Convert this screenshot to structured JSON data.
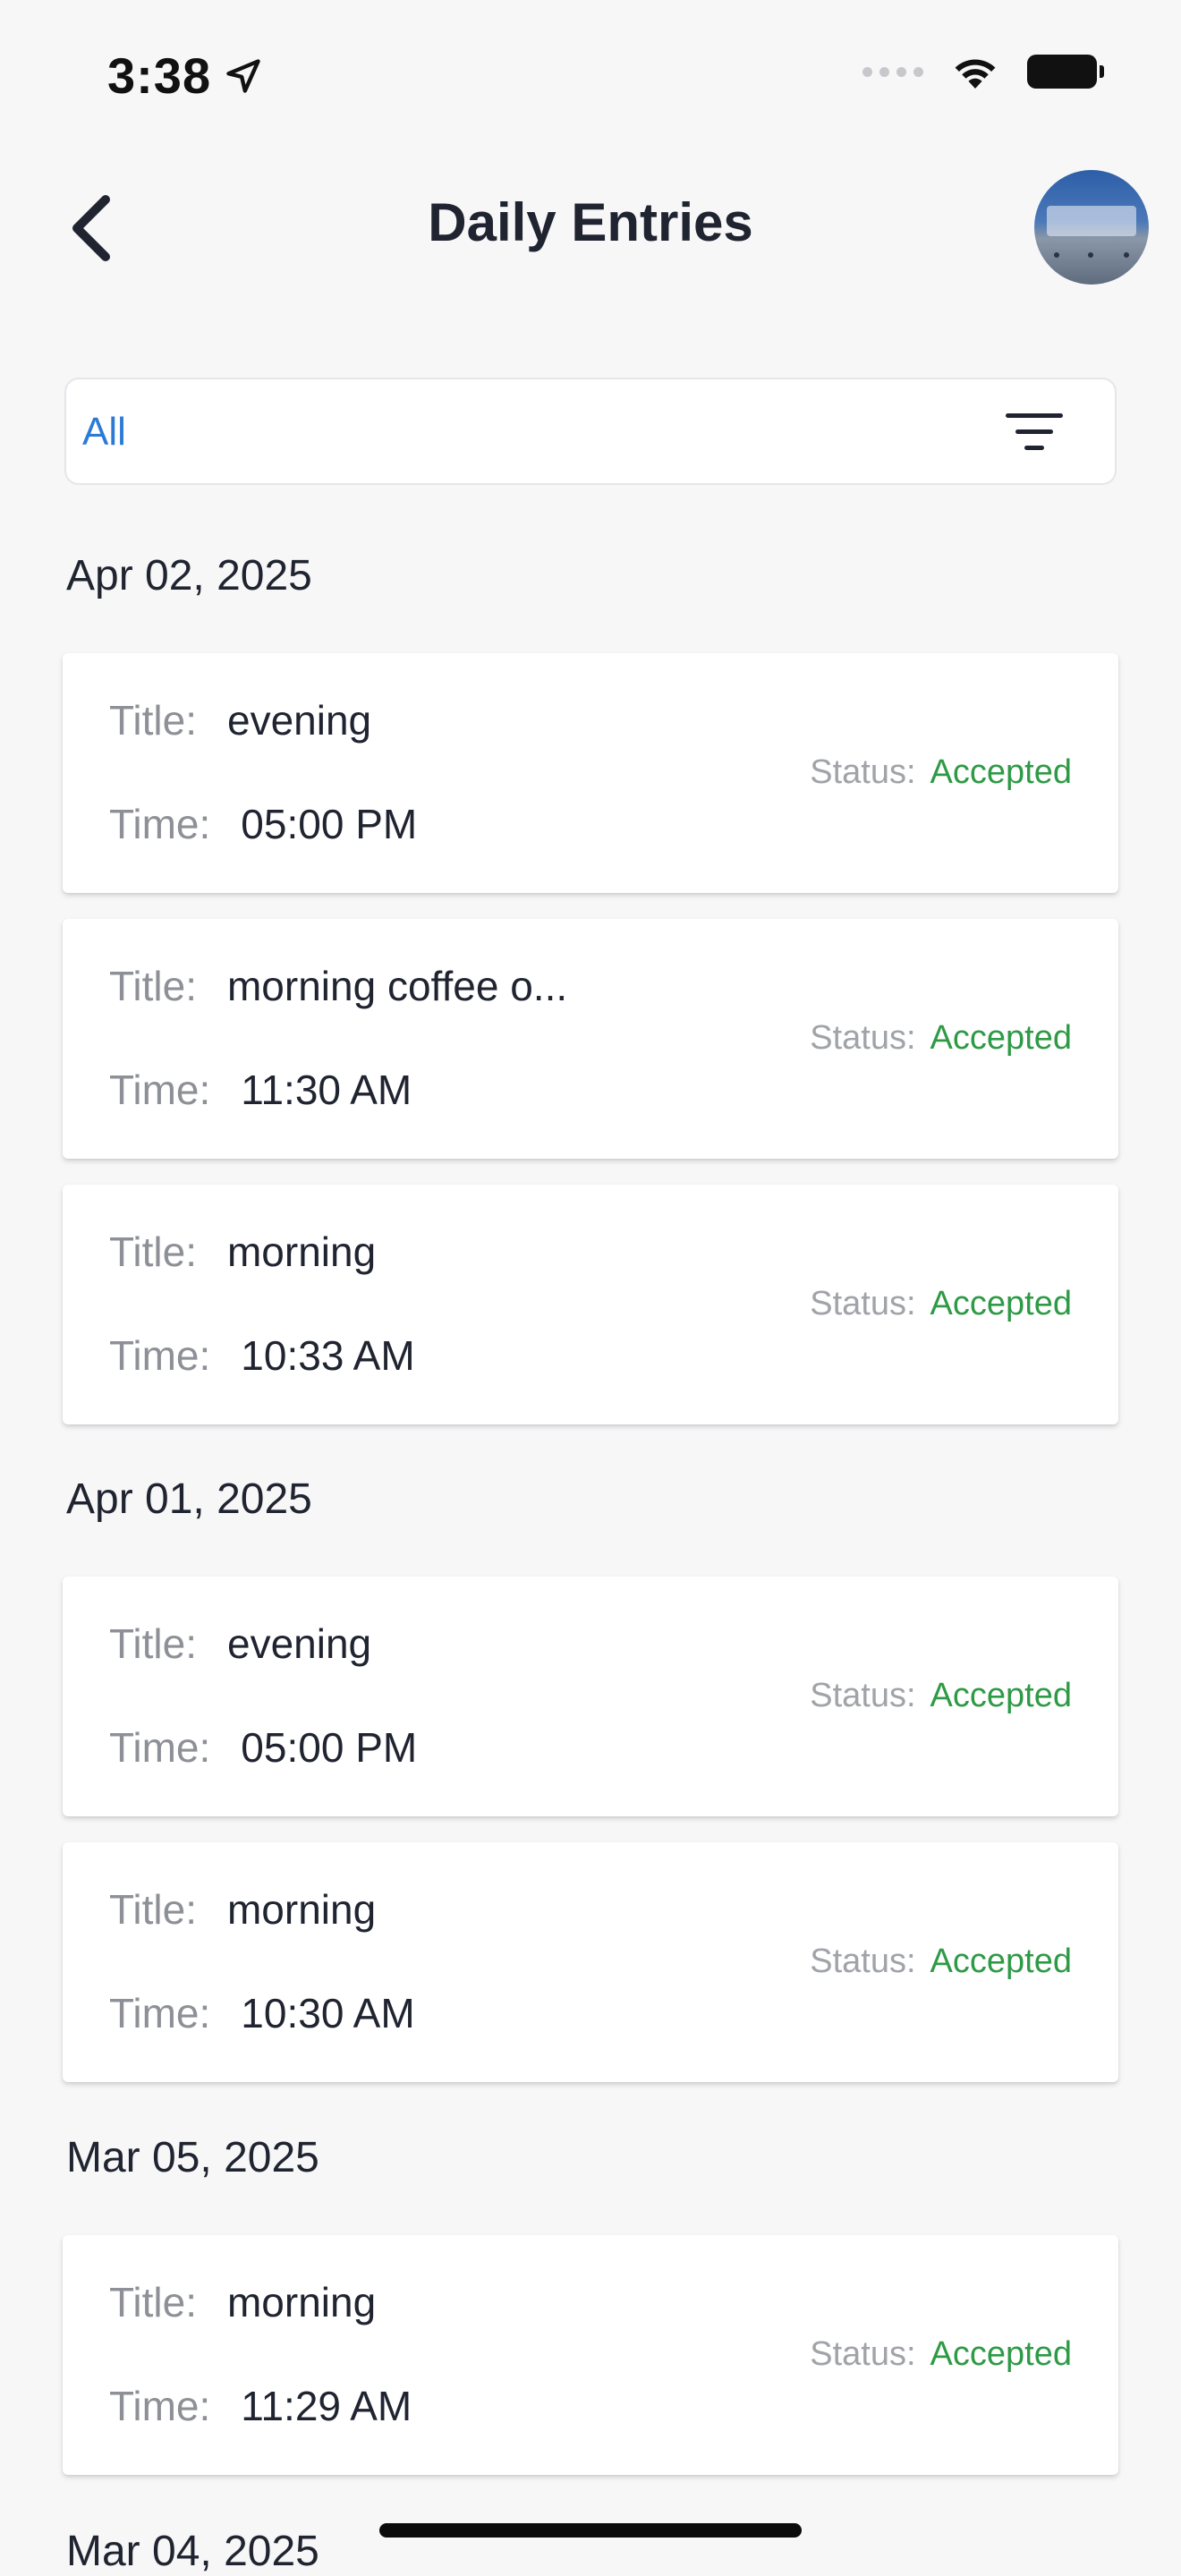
{
  "status_bar": {
    "time": "3:38",
    "icons": [
      "location-arrow-icon",
      "signal-icon",
      "wifi-icon",
      "battery-icon"
    ]
  },
  "header": {
    "title": "Daily Entries",
    "back_icon": "chevron-left-icon"
  },
  "filter": {
    "value": "All",
    "icon": "filter-lines-icon"
  },
  "colors": {
    "accent_blue": "#2b7bd6",
    "status_green": "#2f9a46",
    "label_gray": "#8d9096",
    "text_dark": "#1f2430",
    "background": "#f7f7f8"
  },
  "labels": {
    "title": "Title:",
    "time": "Time:",
    "status": "Status:"
  },
  "groups": [
    {
      "date": "Apr 02, 2025",
      "entries": [
        {
          "title": "evening",
          "time": "05:00 PM",
          "status": "Accepted"
        },
        {
          "title": "morning coffee o...",
          "time": "11:30 AM",
          "status": "Accepted"
        },
        {
          "title": "morning",
          "time": "10:33 AM",
          "status": "Accepted"
        }
      ]
    },
    {
      "date": "Apr 01, 2025",
      "entries": [
        {
          "title": "evening",
          "time": "05:00 PM",
          "status": "Accepted"
        },
        {
          "title": "morning",
          "time": "10:30 AM",
          "status": "Accepted"
        }
      ]
    },
    {
      "date": "Mar 05, 2025",
      "entries": [
        {
          "title": "morning",
          "time": "11:29 AM",
          "status": "Accepted"
        }
      ]
    },
    {
      "date": "Mar 04, 2025",
      "entries": []
    }
  ]
}
